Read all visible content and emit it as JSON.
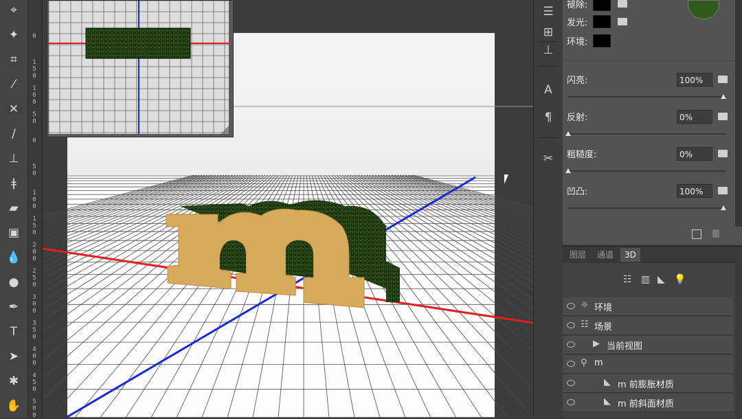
{
  "toolbar": {
    "tools": [
      {
        "name": "path-select-tool-icon",
        "glyph": "⌖"
      },
      {
        "name": "magic-wand-icon",
        "glyph": "✦"
      },
      {
        "name": "crop-icon",
        "glyph": "⌗"
      },
      {
        "name": "eyedropper-icon",
        "glyph": "⁄"
      },
      {
        "name": "healing-brush-icon",
        "glyph": "✕"
      },
      {
        "name": "brush-icon",
        "glyph": "∕"
      },
      {
        "name": "clone-stamp-icon",
        "glyph": "⊥"
      },
      {
        "name": "history-brush-icon",
        "glyph": "ǂ"
      },
      {
        "name": "eraser-icon",
        "glyph": "▰"
      },
      {
        "name": "gradient-icon",
        "glyph": "▣"
      },
      {
        "name": "blur-icon",
        "glyph": "💧"
      },
      {
        "name": "dodge-icon",
        "glyph": "●"
      },
      {
        "name": "pen-icon",
        "glyph": "✒"
      },
      {
        "name": "type-icon",
        "glyph": "T"
      },
      {
        "name": "path-selection-icon",
        "glyph": "➤"
      },
      {
        "name": "3d-rotate-icon",
        "glyph": "✱"
      },
      {
        "name": "hand-icon",
        "glyph": "✋"
      }
    ]
  },
  "ruler": {
    "ticks": [
      "0",
      "1 5 0",
      "1 0 0",
      "5 0",
      "0",
      "5 0",
      "1 0 0",
      "1 5 0",
      "2 0 0",
      "2 5 0",
      "3 0 0",
      "3 5 0",
      "4 0 0",
      "4 5 0",
      "5 0 0"
    ]
  },
  "properties": {
    "labels": {
      "bump": "褪除:",
      "illumination": "发光:",
      "ambient": "环境:"
    },
    "opacity": {
      "label": "闪亮:",
      "value": "100%",
      "thumb": 1.0
    },
    "reflection": {
      "label": "反射:",
      "value": "0%",
      "thumb": 0.0
    },
    "roughness": {
      "label": "粗糙度:",
      "value": "0%",
      "thumb": 0.0
    },
    "bump_strength": {
      "label": "凹凸:",
      "value": "100%",
      "thumb": 1.0
    }
  },
  "panel3d": {
    "tabs": [
      "图层",
      "通道",
      "3D"
    ],
    "active_tab": "3D",
    "rows": [
      {
        "label": "环境",
        "icon": "environment-icon",
        "glyph": "☼"
      },
      {
        "label": "场景",
        "icon": "scene-icon",
        "glyph": "☷"
      },
      {
        "label": "当前视图",
        "icon": "camera-icon",
        "glyph": "▶"
      },
      {
        "label": "m",
        "icon": "mesh-icon",
        "glyph": "⚲"
      },
      {
        "label": "m 前膨胀材质",
        "icon": "material-icon",
        "glyph": "◣"
      },
      {
        "label": "m 前斜面材质",
        "icon": "material-icon",
        "glyph": "◣"
      }
    ]
  },
  "canvas": {
    "extruded_text": "m"
  },
  "colors": {
    "x_axis": "#e02020",
    "z_axis": "#1a2ad6",
    "text_face": "#d8ab5c",
    "text_side": "#1e3a12"
  }
}
